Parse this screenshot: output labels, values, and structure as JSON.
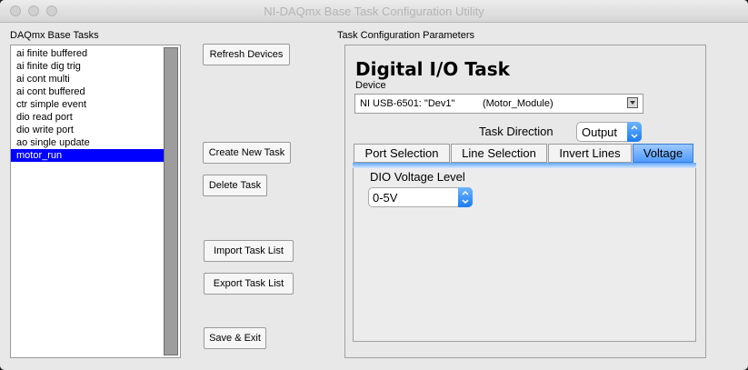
{
  "window": {
    "title": "NI-DAQmx Base Task Configuration Utility"
  },
  "tasks": {
    "heading": "DAQmx Base Tasks",
    "items": [
      "ai finite buffered",
      "ai finite dig trig",
      "ai cont multi",
      "ai cont buffered",
      "ctr simple event",
      "dio read port",
      "dio write port",
      "ao single update",
      "motor_run"
    ],
    "selected": "motor_run"
  },
  "buttons": {
    "refresh": "Refresh Devices",
    "create": "Create New Task",
    "delete": "Delete Task",
    "import": "Import Task List",
    "export": "Export Task List",
    "save_exit": "Save & Exit"
  },
  "config": {
    "heading": "Task Configuration Parameters",
    "task_title": "Digital I/O Task",
    "device_label": "Device",
    "device_value": "NI USB-6501: \"Dev1\"          (Motor_Module)",
    "direction_label": "Task Direction",
    "direction_value": "Output",
    "tabs": [
      "Port Selection",
      "Line Selection",
      "Invert Lines",
      "Voltage"
    ],
    "active_tab": "Voltage",
    "voltage_label": "DIO Voltage Level",
    "voltage_value": "0-5V"
  }
}
